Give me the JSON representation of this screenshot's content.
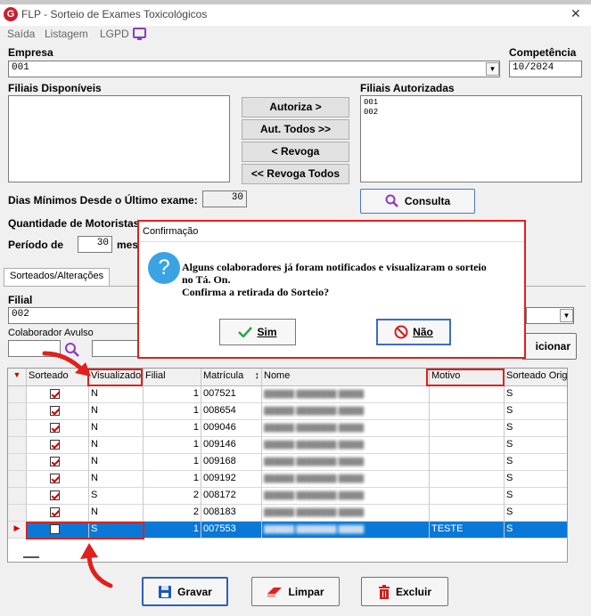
{
  "window": {
    "app_icon": "G",
    "title": "FLP - Sorteio de Exames Toxicológicos",
    "close": "✕"
  },
  "menu": [
    "Saída",
    "Listagem",
    "LGPD"
  ],
  "empresa": {
    "label": "Empresa",
    "value": "001"
  },
  "competencia": {
    "label": "Competência",
    "value": "10/2024"
  },
  "filiais_disponiveis": {
    "label": "Filiais Disponíveis"
  },
  "filiais_autorizadas": {
    "label": "Filiais Autorizadas",
    "items": [
      "001",
      "002"
    ]
  },
  "buttons_middle": {
    "autoriza": "Autoriza >",
    "aut_todos": "Aut. Todos >>",
    "revoga": "< Revoga",
    "revoga_todos": "<< Revoga Todos"
  },
  "consulta": "Consulta",
  "dias_minimos": {
    "label": "Dias Mínimos Desde o Último exame:",
    "value": "30"
  },
  "qtd_motoristas": {
    "label": "Quantidade de Motoristas"
  },
  "periodo": {
    "label": "Período de",
    "value": "30",
    "suffix": "mes"
  },
  "tab": "Sorteados/Alterações",
  "filial": {
    "label": "Filial",
    "value": "002"
  },
  "colaborador_avulso": {
    "label": "Colaborador Avulso"
  },
  "adicionar_partial": "icionar",
  "grid": {
    "columns": [
      "Sorteado",
      "Visualizado",
      "Filial",
      "Matrícula",
      "Nome",
      "Motivo",
      "Sorteado Origi"
    ],
    "rows": [
      {
        "sorteado": true,
        "visualizado": "N",
        "filial": "1",
        "matricula": "007521",
        "motivo": "",
        "origem": "S"
      },
      {
        "sorteado": true,
        "visualizado": "N",
        "filial": "1",
        "matricula": "008654",
        "motivo": "",
        "origem": "S"
      },
      {
        "sorteado": true,
        "visualizado": "N",
        "filial": "1",
        "matricula": "009046",
        "motivo": "",
        "origem": "S"
      },
      {
        "sorteado": true,
        "visualizado": "N",
        "filial": "1",
        "matricula": "009146",
        "motivo": "",
        "origem": "S"
      },
      {
        "sorteado": true,
        "visualizado": "N",
        "filial": "1",
        "matricula": "009168",
        "motivo": "",
        "origem": "S"
      },
      {
        "sorteado": true,
        "visualizado": "N",
        "filial": "1",
        "matricula": "009192",
        "motivo": "",
        "origem": "S"
      },
      {
        "sorteado": true,
        "visualizado": "S",
        "filial": "2",
        "matricula": "008172",
        "motivo": "",
        "origem": "S"
      },
      {
        "sorteado": true,
        "visualizado": "N",
        "filial": "2",
        "matricula": "008183",
        "motivo": "",
        "origem": "S"
      },
      {
        "sorteado": false,
        "visualizado": "S",
        "filial": "1",
        "matricula": "007553",
        "motivo": "TESTE",
        "origem": "S",
        "selected": true
      }
    ]
  },
  "footer_buttons": {
    "gravar": "Gravar",
    "limpar": "Limpar",
    "excluir": "Excluir"
  },
  "dialog": {
    "title": "Confirmação",
    "line1": "Alguns colaboradores já foram notificados e visualizaram o sorteio",
    "line2": "no Tá. On.",
    "line3": "Confirma a retirada do Sorteio?",
    "sim": "Sim",
    "nao": "Não"
  },
  "colors": {
    "accent_red": "#e0201c",
    "selection": "#0a78d7",
    "lgpd_purple": "#8a3cc4"
  }
}
